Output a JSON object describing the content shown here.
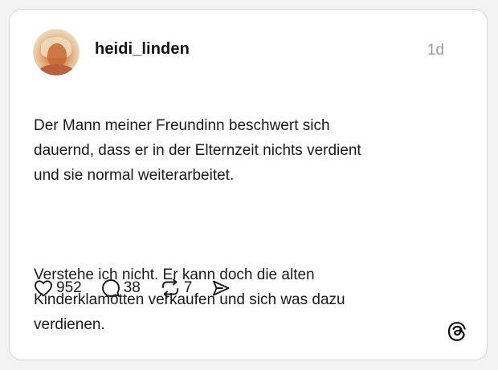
{
  "post": {
    "username": "heidi_linden",
    "timestamp": "1d",
    "paragraphs": [
      "Der Mann meiner Freundinn beschwert sich\ndauernd, dass er in der Elternzeit nichts verdient\nund sie normal weiterarbeitet.",
      "Verstehe ich nicht. Er kann doch die alten\nKinderklamotten verkaufen und sich was dazu\nverdienen."
    ]
  },
  "actions": {
    "likes": "952",
    "replies": "38",
    "reposts": "7"
  },
  "icons": {
    "like": "heart-icon",
    "reply": "comment-icon",
    "repost": "repost-icon",
    "share": "share-icon",
    "brand": "threads-logo-icon"
  },
  "colors": {
    "text": "#1a1a1a",
    "muted": "#9a9a9a",
    "card_border": "#d6d6d6",
    "background": "#f3f3f3"
  }
}
